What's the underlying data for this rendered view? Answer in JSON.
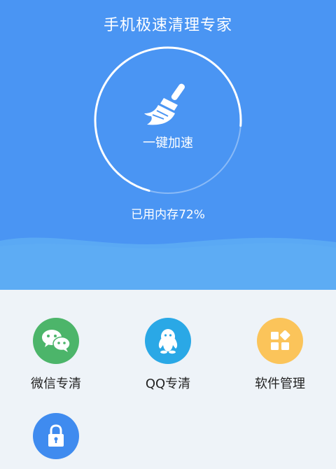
{
  "header": {
    "title": "手机极速清理专家"
  },
  "boost": {
    "label": "一键加速",
    "memory_text": "已用内存72%",
    "memory_used_fraction": 0.72,
    "icon": "broom-icon"
  },
  "colors": {
    "hero": "#4a95f3",
    "wave": "#5aa9f4",
    "background": "#eef3f8",
    "wechat": "#4cb56a",
    "qq": "#2aa8e6",
    "apps": "#fbc45a",
    "lock": "#3f8bef"
  },
  "tools": [
    {
      "label": "微信专清",
      "icon": "wechat-icon"
    },
    {
      "label": "QQ专清",
      "icon": "qq-icon"
    },
    {
      "label": "软件管理",
      "icon": "apps-grid-icon"
    },
    {
      "label": "",
      "icon": "lock-icon"
    }
  ]
}
